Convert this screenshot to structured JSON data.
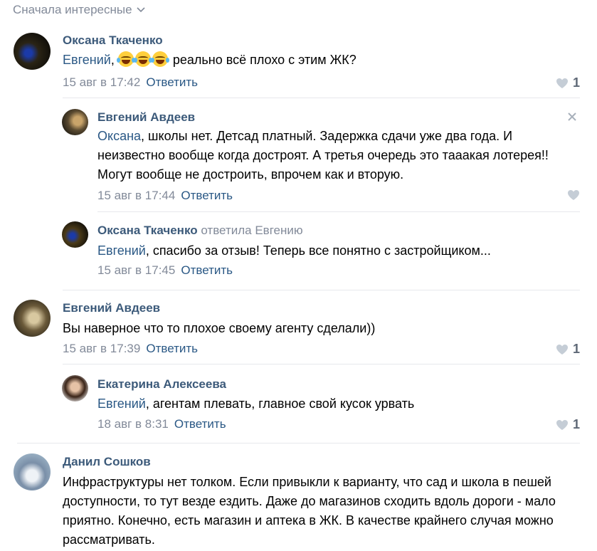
{
  "sort_label": "Сначала интересные",
  "colors": {
    "accent": "#2a5885",
    "author": "#3c5a7a",
    "muted": "#828a99"
  },
  "comments": [
    {
      "author": "Оксана Ткаченко",
      "mention": "Евгений",
      "text_after_emoji": "реально всё плохо с этим ЖК?",
      "emoji_count": "3",
      "date": "15 авг в 17:42",
      "reply_label": "Ответить",
      "likes": "1"
    },
    {
      "author": "Евгений Авдеев",
      "mention": "Оксана",
      "text": ", школы нет. Детсад платный. Задержка сдачи уже два года. И неизвестно вообще когда достроят. А третья очередь это тааакая лотерея!! Могут вообще не достроить, впрочем как и вторую.",
      "date": "15 авг в 17:44",
      "reply_label": "Ответить"
    },
    {
      "author": "Оксана Ткаченко",
      "replied_to": "ответила Евгению",
      "mention": "Евгений",
      "text": ", спасибо за отзыв! Теперь все понятно с застройщиком...",
      "date": "15 авг в 17:45",
      "reply_label": "Ответить"
    },
    {
      "author": "Евгений Авдеев",
      "text": "Вы наверное что то плохое своему агенту сделали))",
      "date": "15 авг в 17:39",
      "reply_label": "Ответить",
      "likes": "1"
    },
    {
      "author": "Екатерина Алексеева",
      "mention": "Евгений",
      "text": ", агентам плевать, главное свой кусок урвать",
      "date": "18 авг в 8:31",
      "reply_label": "Ответить",
      "likes": "1"
    },
    {
      "author": "Данил Сошков",
      "text": "Инфраструктуры нет толком. Если привыкли к варианту, что сад и школа в пешей доступности, то тут везде ездить. Даже до магазинов сходить вдоль дороги - мало приятно. Конечно, есть магазин и аптека в ЖК. В качестве крайнего случая можно рассматривать."
    }
  ]
}
